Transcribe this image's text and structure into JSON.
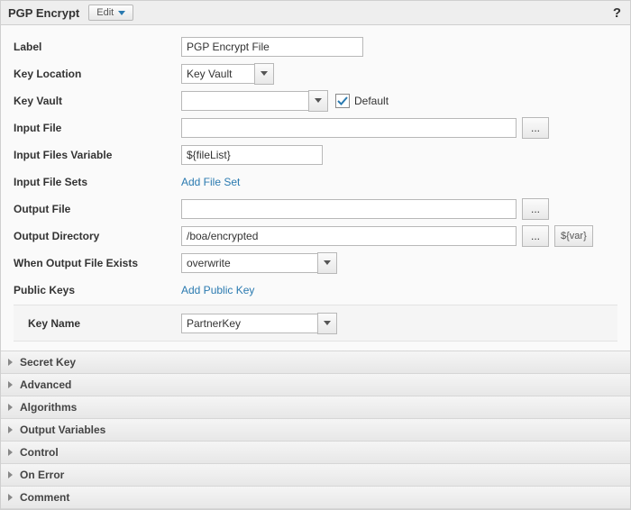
{
  "header": {
    "title": "PGP Encrypt",
    "edit": "Edit",
    "help": "?"
  },
  "labels": {
    "label": "Label",
    "keyLocation": "Key Location",
    "keyVault": "Key Vault",
    "inputFile": "Input File",
    "inputFilesVariable": "Input Files Variable",
    "inputFileSets": "Input File Sets",
    "outputFile": "Output File",
    "outputDirectory": "Output Directory",
    "whenOutputFileExists": "When Output File Exists",
    "publicKeys": "Public Keys",
    "keyName": "Key Name",
    "default": "Default"
  },
  "values": {
    "label": "PGP Encrypt File",
    "keyLocation": "Key Vault",
    "keyVault": "",
    "inputFile": "",
    "inputFilesVariable": "${fileList}",
    "outputFile": "",
    "outputDirectory": "/boa/encrypted",
    "whenOutputFileExists": "overwrite",
    "keyName": "PartnerKey"
  },
  "links": {
    "addFileSet": "Add File Set",
    "addPublicKey": "Add Public Key"
  },
  "buttons": {
    "browse": "...",
    "var": "${var}"
  },
  "accordion": [
    "Secret Key",
    "Advanced",
    "Algorithms",
    "Output Variables",
    "Control",
    "On Error",
    "Comment"
  ]
}
